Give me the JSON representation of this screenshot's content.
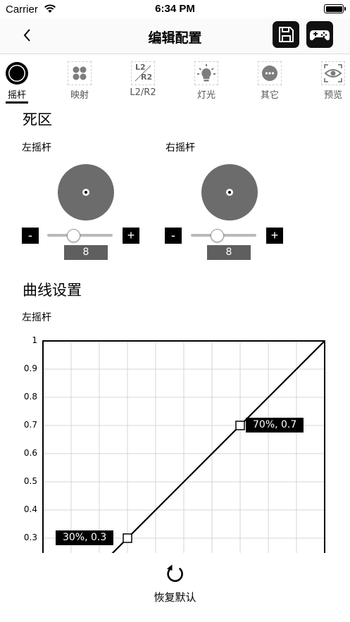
{
  "status_bar": {
    "carrier": "Carrier",
    "time": "6:34 PM"
  },
  "nav": {
    "title": "编辑配置",
    "back_icon": "chevron-left-icon",
    "save_icon": "save-icon",
    "gamepad_icon": "gamepad-icon"
  },
  "tabs": [
    {
      "label": "摇杆",
      "icon": "joystick-icon",
      "active": true
    },
    {
      "label": "映射",
      "icon": "buttons-grid-icon",
      "active": false
    },
    {
      "label": "L2/R2",
      "icon": "trigger-icon",
      "active": false,
      "icon_text_top": "L2",
      "icon_text_bottom": "R2"
    },
    {
      "label": "灯光",
      "icon": "bulb-icon",
      "active": false
    },
    {
      "label": "其它",
      "icon": "more-icon",
      "active": false
    },
    {
      "label": "预览",
      "icon": "eye-icon",
      "active": false
    }
  ],
  "deadzone": {
    "title": "死区",
    "left": {
      "label": "左摇杆",
      "minus": "-",
      "plus": "+",
      "value": "8",
      "slider_fraction": 0.4
    },
    "right": {
      "label": "右摇杆",
      "minus": "-",
      "plus": "+",
      "value": "8",
      "slider_fraction": 0.4
    }
  },
  "curve": {
    "title": "曲线设置",
    "stick_label": "左摇杆",
    "y_ticks": [
      "1",
      "0.9",
      "0.8",
      "0.7",
      "0.6",
      "0.5",
      "0.4",
      "0.3"
    ],
    "annotations": [
      "70%, 0.7",
      "30%, 0.3"
    ]
  },
  "chart_data": {
    "type": "line",
    "x": [
      0.0,
      0.3,
      0.7,
      1.0
    ],
    "y": [
      0.0,
      0.3,
      0.7,
      1.0
    ],
    "control_points": [
      {
        "x": 0.3,
        "y": 0.3,
        "label": "30%, 0.3"
      },
      {
        "x": 0.7,
        "y": 0.7,
        "label": "70%, 0.7"
      }
    ],
    "ylim": [
      0,
      1
    ],
    "xlim": [
      0,
      1
    ],
    "grid": true,
    "y_ticks_visible": [
      1,
      0.9,
      0.8,
      0.7,
      0.6,
      0.5,
      0.4,
      0.3
    ]
  },
  "bottom": {
    "reset_label": "恢复默认",
    "reset_icon": "refresh-icon"
  }
}
